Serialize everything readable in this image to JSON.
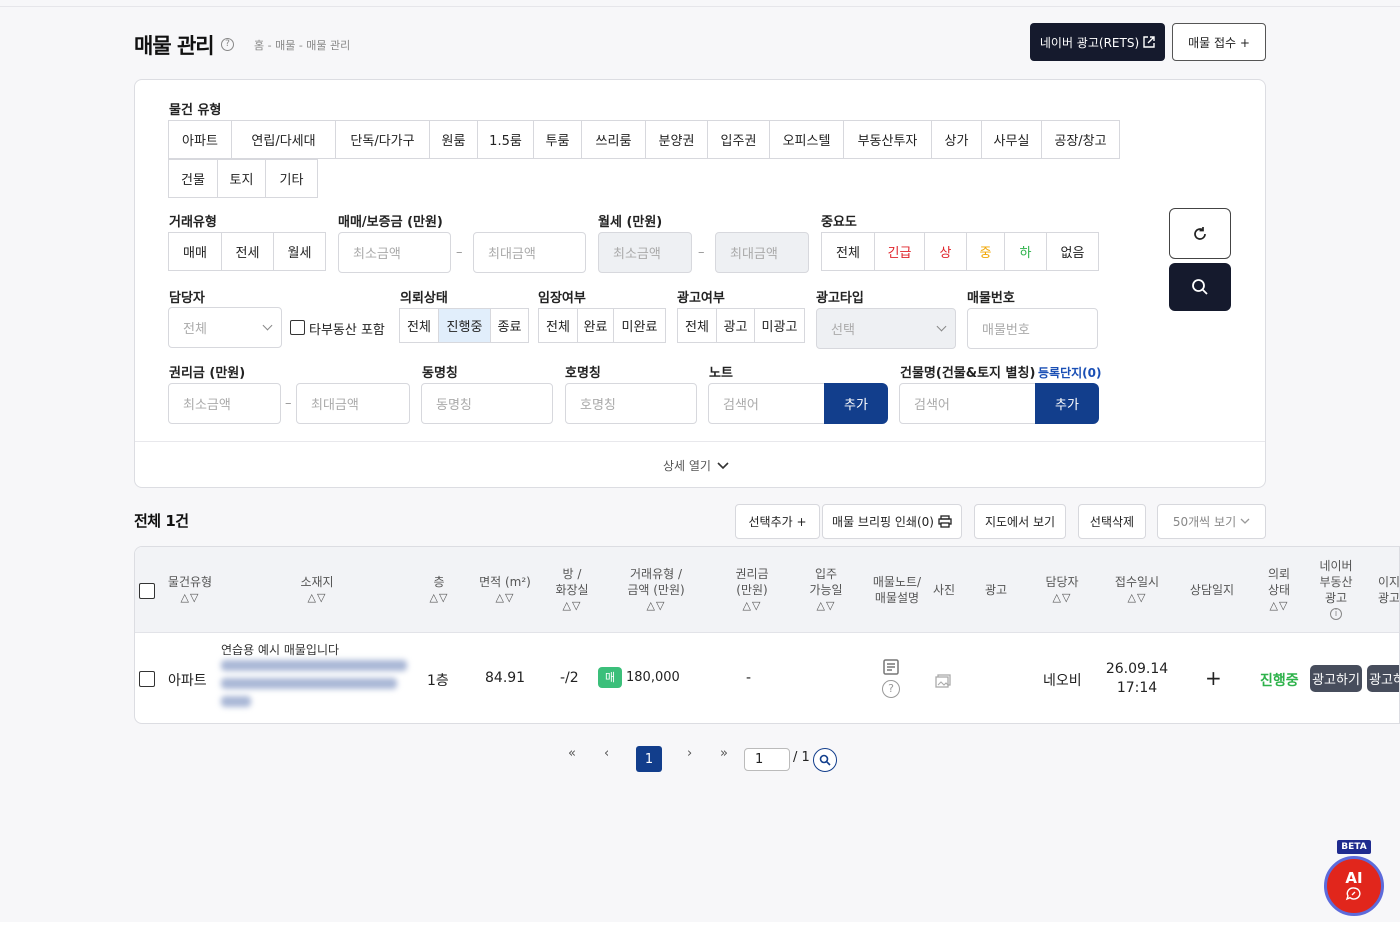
{
  "header": {
    "title": "매물 관리",
    "breadcrumb": "홈 - 매물 - 매물 관리",
    "naver_ad_button": "네이버 광고(RETS)",
    "receive_button": "매물 접수 +"
  },
  "filters": {
    "property_type_label": "물건 유형",
    "property_types_row1": [
      "아파트",
      "연립/다세대",
      "단독/다가구",
      "원룸",
      "1.5룸",
      "투룸",
      "쓰리룸",
      "분양권",
      "입주권",
      "오피스텔",
      "부동산투자",
      "상가",
      "사무실",
      "공장/창고"
    ],
    "property_types_row2": [
      "건물",
      "토지",
      "기타"
    ],
    "deal_type_label": "거래유형",
    "deal_types": [
      "매매",
      "전세",
      "월세"
    ],
    "deposit_label": "매매/보증금 (만원)",
    "rent_label": "월세 (만원)",
    "min_placeholder": "최소금액",
    "max_placeholder": "최대금액",
    "dash": "–",
    "importance_label": "중요도",
    "importance": [
      {
        "label": "전체",
        "color": "#222222"
      },
      {
        "label": "긴급",
        "color": "#e0242b"
      },
      {
        "label": "상",
        "color": "#e0242b"
      },
      {
        "label": "중",
        "color": "#f0a500"
      },
      {
        "label": "하",
        "color": "#2db24a"
      },
      {
        "label": "없음",
        "color": "#222222"
      }
    ],
    "manager_label": "담당자",
    "manager_value": "전체",
    "other_agency_label": "타부동산 포함",
    "request_status_label": "의뢰상태",
    "request_status": [
      "전체",
      "진행중",
      "종료"
    ],
    "inspection_label": "임장여부",
    "inspection": [
      "전체",
      "완료",
      "미완료"
    ],
    "ad_status_label": "광고여부",
    "ad_status": [
      "전체",
      "광고",
      "미광고"
    ],
    "ad_type_label": "광고타입",
    "ad_type_placeholder": "선택",
    "property_no_label": "매물번호",
    "property_no_placeholder": "매물번호",
    "premium_label": "권리금 (만원)",
    "dong_label": "동명칭",
    "dong_placeholder": "동명칭",
    "ho_label": "호명칭",
    "ho_placeholder": "호명칭",
    "note_label": "노트",
    "search_placeholder": "검색어",
    "add_label": "추가",
    "building_label": "건물명(건물&토지 별칭)",
    "registered_complex": "등록단지(0)",
    "detail_toggle": "상세 열기"
  },
  "toolbar": {
    "total": "전체 1건",
    "select_add": "선택추가 +",
    "print": "매물 브리핑 인쇄(0)",
    "map_view": "지도에서 보기",
    "delete_selected": "선택삭제",
    "page_size": "50개씩 보기"
  },
  "table": {
    "headers": {
      "type": "물건유형",
      "location": "소재지",
      "floor": "층",
      "area": "면적 (m²)",
      "rooms_1": "방 /",
      "rooms_2": "화장실",
      "deal_1": "거래유형 /",
      "deal_2": "금액 (만원)",
      "premium_1": "권리금",
      "premium_2": "(만원)",
      "movein_1": "입주",
      "movein_2": "가능일",
      "note_1": "매물노트/",
      "note_2": "매물설명",
      "photo": "사진",
      "ad": "광고",
      "manager": "담당자",
      "received": "접수일시",
      "consult": "상담일지",
      "status_1": "의뢰",
      "status_2": "상태",
      "naver_1": "네이버",
      "naver_2": "부동산",
      "naver_3": "광고",
      "izi_1": "이지",
      "izi_2": "광고",
      "sort": "△▽"
    },
    "rows": [
      {
        "type": "아파트",
        "memo": "연습용 예시 매물입니다",
        "floor": "1층",
        "area": "84.91",
        "rooms": "-/2",
        "deal_badge": "매",
        "amount": "180,000",
        "premium": "-",
        "manager": "네오비",
        "received_date": "26.09.14",
        "received_time": "17:14",
        "consult": "+",
        "status": "진행중",
        "naver_ad": "광고하기",
        "izi_ad": "광고하기"
      }
    ]
  },
  "pagination": {
    "first": "«",
    "prev": "‹",
    "current": "1",
    "next": "›",
    "last": "»",
    "input_value": "1",
    "total": "/ 1"
  },
  "ai": {
    "beta": "BETA",
    "label": "AI"
  }
}
